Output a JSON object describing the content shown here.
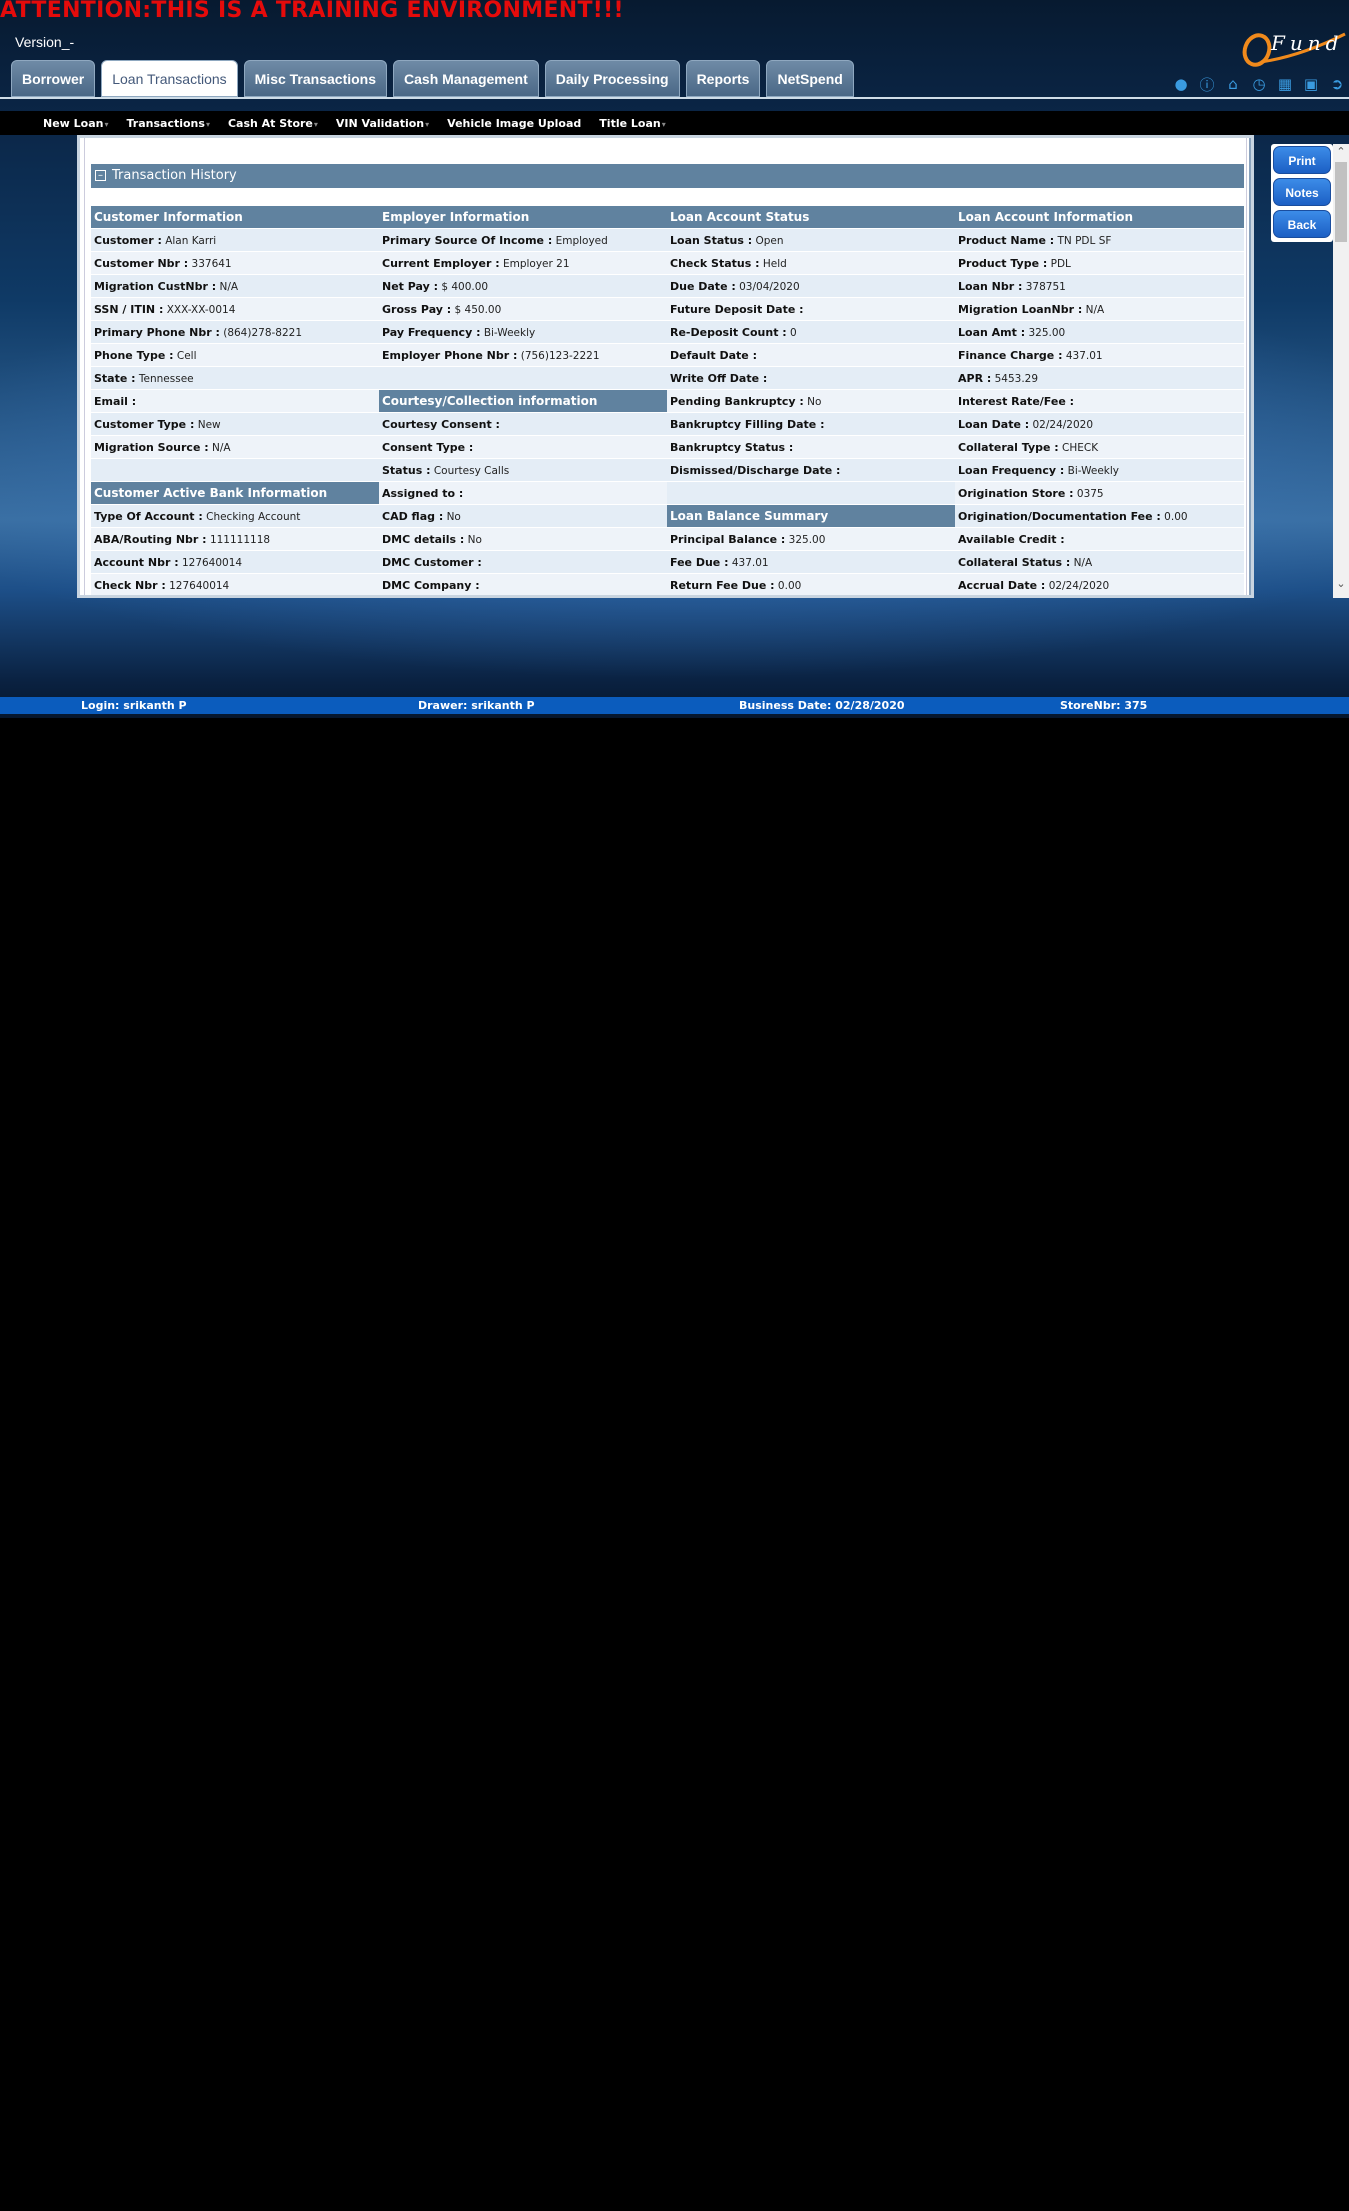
{
  "attention": "ATTENTION:THIS IS A TRAINING ENVIRONMENT!!!",
  "version": "Version_-",
  "logo_text": "Fund",
  "tabs": [
    {
      "label": "Borrower",
      "active": false
    },
    {
      "label": "Loan Transactions",
      "active": true
    },
    {
      "label": "Misc Transactions",
      "active": false
    },
    {
      "label": "Cash Management",
      "active": false
    },
    {
      "label": "Daily Processing",
      "active": false
    },
    {
      "label": "Reports",
      "active": false
    },
    {
      "label": "NetSpend",
      "active": false
    }
  ],
  "top_icons": [
    "user-icon",
    "info-icon",
    "home-icon",
    "clock-icon",
    "calculator-icon",
    "lock-icon",
    "logout-icon"
  ],
  "subnav": [
    {
      "label": "New Loan",
      "caret": true
    },
    {
      "label": "Transactions",
      "caret": true
    },
    {
      "label": "Cash At Store",
      "caret": true
    },
    {
      "label": "VIN Validation",
      "caret": true
    },
    {
      "label": "Vehicle Image Upload",
      "caret": false
    },
    {
      "label": "Title Loan",
      "caret": true
    }
  ],
  "section_title": "Transaction History",
  "columns": [
    {
      "rows": [
        {
          "type": "header",
          "text": "Customer Information"
        },
        {
          "label": "Customer :",
          "value": "Alan Karri"
        },
        {
          "label": "Customer Nbr :",
          "value": "337641"
        },
        {
          "label": "Migration CustNbr :",
          "value": "N/A"
        },
        {
          "label": "SSN / ITIN :",
          "value": "XXX-XX-0014"
        },
        {
          "label": "Primary Phone Nbr :",
          "value": "(864)278-8221"
        },
        {
          "label": "Phone Type :",
          "value": "Cell"
        },
        {
          "label": "State :",
          "value": "Tennessee"
        },
        {
          "label": "Email :",
          "value": ""
        },
        {
          "label": "Customer Type :",
          "value": "New"
        },
        {
          "label": "Migration Source :",
          "value": "N/A"
        },
        {
          "type": "blank"
        },
        {
          "type": "header",
          "text": "Customer Active Bank Information"
        },
        {
          "label": "Type Of Account :",
          "value": "Checking Account"
        },
        {
          "label": "ABA/Routing Nbr :",
          "value": "111111118"
        },
        {
          "label": "Account Nbr :",
          "value": "127640014"
        },
        {
          "label": "Check Nbr :",
          "value": "127640014"
        }
      ]
    },
    {
      "rows": [
        {
          "type": "header",
          "text": "Employer Information"
        },
        {
          "label": "Primary Source Of Income :",
          "value": "Employed"
        },
        {
          "label": "Current Employer :",
          "value": "Employer 21"
        },
        {
          "label": "Net Pay :",
          "value": "$ 400.00"
        },
        {
          "label": "Gross Pay :",
          "value": "$ 450.00"
        },
        {
          "label": "Pay Frequency :",
          "value": "Bi-Weekly"
        },
        {
          "label": "Employer Phone Nbr :",
          "value": "(756)123-2221"
        },
        {
          "type": "blank"
        },
        {
          "type": "header",
          "text": "Courtesy/Collection information"
        },
        {
          "label": "Courtesy Consent :",
          "value": ""
        },
        {
          "label": "Consent Type :",
          "value": ""
        },
        {
          "label": "Status :",
          "value": "Courtesy Calls"
        },
        {
          "label": "Assigned to :",
          "value": ""
        },
        {
          "label": "CAD flag :",
          "value": "No"
        },
        {
          "label": "DMC details :",
          "value": "No"
        },
        {
          "label": "DMC Customer :",
          "value": ""
        },
        {
          "label": "DMC Company :",
          "value": ""
        }
      ]
    },
    {
      "rows": [
        {
          "type": "header",
          "text": "Loan Account Status"
        },
        {
          "label": "Loan Status :",
          "value": "Open"
        },
        {
          "label": "Check Status :",
          "value": "Held"
        },
        {
          "label": "Due Date :",
          "value": "03/04/2020"
        },
        {
          "label": "Future Deposit Date :",
          "value": ""
        },
        {
          "label": "Re-Deposit Count :",
          "value": "0"
        },
        {
          "label": "Default Date :",
          "value": ""
        },
        {
          "label": "Write Off Date :",
          "value": ""
        },
        {
          "label": "Pending Bankruptcy :",
          "value": "No"
        },
        {
          "label": "Bankruptcy Filling Date :",
          "value": ""
        },
        {
          "label": "Bankruptcy Status :",
          "value": ""
        },
        {
          "label": "Dismissed/Discharge Date :",
          "value": ""
        },
        {
          "type": "blank"
        },
        {
          "type": "header",
          "text": "Loan Balance Summary"
        },
        {
          "label": "Principal Balance :",
          "value": "325.00"
        },
        {
          "label": "Fee Due :",
          "value": "437.01"
        },
        {
          "label": "Return Fee Due :",
          "value": "0.00"
        }
      ]
    },
    {
      "rows": [
        {
          "type": "header",
          "text": "Loan Account Information"
        },
        {
          "label": "Product Name :",
          "value": "TN PDL SF"
        },
        {
          "label": "Product Type :",
          "value": "PDL"
        },
        {
          "label": "Loan Nbr :",
          "value": "378751"
        },
        {
          "label": "Migration LoanNbr :",
          "value": "N/A"
        },
        {
          "label": "Loan Amt :",
          "value": "325.00"
        },
        {
          "label": "Finance Charge :",
          "value": "437.01"
        },
        {
          "label": "APR :",
          "value": "5453.29"
        },
        {
          "label": "Interest Rate/Fee :",
          "value": ""
        },
        {
          "label": "Loan Date :",
          "value": "02/24/2020"
        },
        {
          "label": "Collateral Type :",
          "value": "CHECK"
        },
        {
          "label": "Loan Frequency :",
          "value": "Bi-Weekly"
        },
        {
          "label": "Origination Store :",
          "value": "0375"
        },
        {
          "label": "Origination/Documentation Fee :",
          "value": "0.00"
        },
        {
          "label": "Available Credit :",
          "value": ""
        },
        {
          "label": "Collateral Status :",
          "value": "N/A"
        },
        {
          "label": "Accrual Date :",
          "value": "02/24/2020"
        }
      ]
    }
  ],
  "buttons": {
    "print": "Print",
    "notes": "Notes",
    "back": "Back"
  },
  "status_bar": {
    "login": "Login: srikanth P",
    "drawer": "Drawer: srikanth P",
    "business_date": "Business Date: 02/28/2020",
    "store": "StoreNbr: 375"
  }
}
